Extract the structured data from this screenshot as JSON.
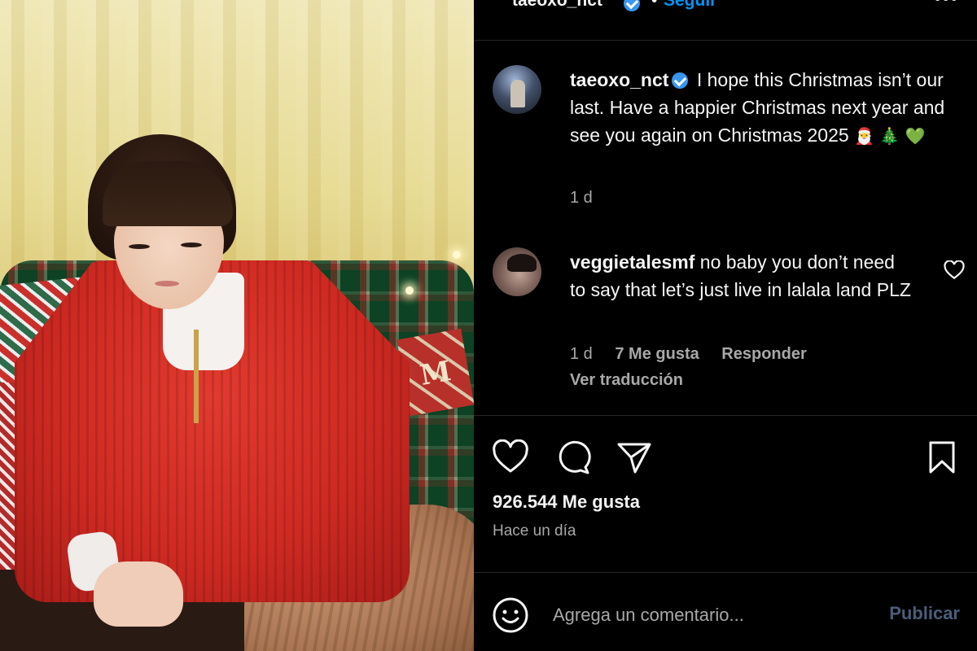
{
  "header": {
    "username": "taeoxo_nct",
    "separator": "•",
    "follow_label": "Seguir",
    "more_icon": "more-horizontal-icon",
    "more_glyph": "•••"
  },
  "post": {
    "image_alt": "Post photo",
    "caption": {
      "username": "taeoxo_nct",
      "text": "I hope this Christmas isn’t our last. Have a happier Christmas next year and see you again on Christmas 2025",
      "emojis": [
        "🎅",
        "🎄",
        "💚"
      ],
      "time": "1 d"
    },
    "likes": "926.544 Me gusta",
    "posted_ago": "Hace un día"
  },
  "comments": [
    {
      "username": "veggietalesmf",
      "text": "no baby you don’t need to say that let’s just live in lalala land PLZ",
      "time": "1 d",
      "likes": "7 Me gusta",
      "reply_label": "Responder",
      "translate_label": "Ver traducción"
    }
  ],
  "composer": {
    "placeholder": "Agrega un comentario...",
    "publish_label": "Publicar"
  },
  "colors": {
    "background": "#000000",
    "link_blue": "#0095f6",
    "secondary_text": "#a8a8a8",
    "verified_badge": "#3897f0",
    "publish_disabled": "#4a5d7a"
  }
}
